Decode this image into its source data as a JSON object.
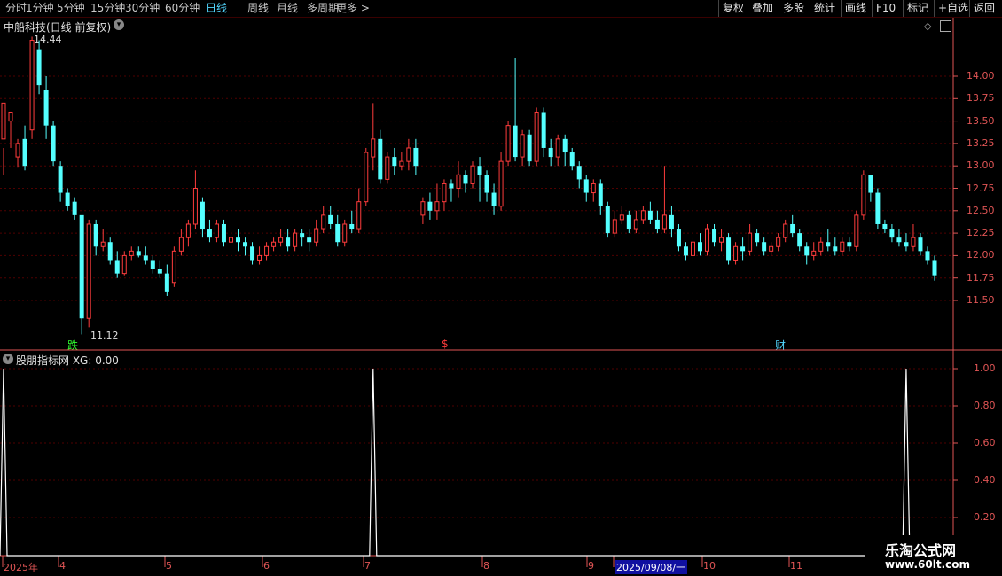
{
  "toolbar": {
    "periods": [
      "分时",
      "1分钟",
      "5分钟",
      "15分钟",
      "30分钟",
      "60分钟",
      "日线",
      "周线",
      "月线",
      "多周期",
      "更多 >"
    ],
    "active_period": "日线",
    "right_buttons": [
      "复权",
      "叠加",
      "多股",
      "统计",
      "画线",
      "F10",
      "标记",
      "+自选",
      "返回"
    ]
  },
  "chart_title": "中船科技(日线 前复权)",
  "indicator_title": "股朋指标网 XG: 0.00",
  "annotations": {
    "high_label": "14.44",
    "low_label": "11.12",
    "marker_die": "跌",
    "marker_dollar": "$",
    "marker_cai": "财"
  },
  "price_axis": [
    "14.00",
    "13.75",
    "13.50",
    "13.25",
    "13.00",
    "12.75",
    "12.50",
    "12.25",
    "12.00",
    "11.75",
    "11.50"
  ],
  "ind_axis": [
    "1.00",
    "0.80",
    "0.60",
    "0.40",
    "0.20"
  ],
  "date_axis": {
    "labels": [
      "2025年",
      "4",
      "5",
      "6",
      "7",
      "8",
      "9",
      "2025/09/08/一",
      "10",
      "11"
    ],
    "highlight": "2025/09/08/一"
  },
  "watermark": {
    "line1": "乐淘公式网",
    "line2": "www.60lt.com"
  },
  "colors": {
    "up": "#ff3c3c",
    "down": "#54ffff",
    "axis": "#e05555",
    "bg": "#000000",
    "active": "#52d7ff"
  },
  "chart_data": {
    "type": "candlestick",
    "y_range": [
      11.1,
      14.5
    ],
    "indicator": {
      "name": "XG",
      "range": [
        0,
        1
      ],
      "signal_candle_index": [
        0,
        52,
        127
      ]
    },
    "candles": [
      [
        13.3,
        13.7,
        13.2,
        12.9
      ],
      [
        13.5,
        13.6,
        13.2,
        13.6
      ],
      [
        13.1,
        13.25,
        12.98,
        13.3
      ],
      [
        13.3,
        13.0,
        12.95,
        13.45
      ],
      [
        13.4,
        14.4,
        13.3,
        14.44
      ],
      [
        14.3,
        13.9,
        13.8,
        14.4
      ],
      [
        13.85,
        13.45,
        13.3,
        14.0
      ],
      [
        13.45,
        13.05,
        13.0,
        13.5
      ],
      [
        13.0,
        12.7,
        12.6,
        13.05
      ],
      [
        12.7,
        12.55,
        12.5,
        12.75
      ],
      [
        12.6,
        12.45,
        12.4,
        12.65
      ],
      [
        12.45,
        11.3,
        11.12,
        12.0
      ],
      [
        11.3,
        12.35,
        11.2,
        12.4
      ],
      [
        12.35,
        12.1,
        12.0,
        12.4
      ],
      [
        12.1,
        12.15,
        12.05,
        12.3
      ],
      [
        12.15,
        11.95,
        11.9,
        12.2
      ],
      [
        11.95,
        11.8,
        11.75,
        12.05
      ],
      [
        11.8,
        12.0,
        11.78,
        12.05
      ],
      [
        12.0,
        12.05,
        11.95,
        12.1
      ],
      [
        12.05,
        12.0,
        11.98,
        12.1
      ],
      [
        12.0,
        11.95,
        11.9,
        12.1
      ],
      [
        11.95,
        11.85,
        11.8,
        12.0
      ],
      [
        11.85,
        11.8,
        11.75,
        11.95
      ],
      [
        11.8,
        11.6,
        11.55,
        11.9
      ],
      [
        11.7,
        12.05,
        11.65,
        12.1
      ],
      [
        12.05,
        12.2,
        12.0,
        12.3
      ],
      [
        12.2,
        12.35,
        12.1,
        12.4
      ],
      [
        12.35,
        12.75,
        12.3,
        12.95
      ],
      [
        12.6,
        12.3,
        12.2,
        12.65
      ],
      [
        12.3,
        12.2,
        12.15,
        12.4
      ],
      [
        12.2,
        12.35,
        12.15,
        12.4
      ],
      [
        12.35,
        12.15,
        12.1,
        12.4
      ],
      [
        12.15,
        12.2,
        12.1,
        12.3
      ],
      [
        12.2,
        12.15,
        12.05,
        12.3
      ],
      [
        12.15,
        12.1,
        12.0,
        12.2
      ],
      [
        12.1,
        11.95,
        11.9,
        12.15
      ],
      [
        11.95,
        12.0,
        11.9,
        12.1
      ],
      [
        12.0,
        12.1,
        11.95,
        12.15
      ],
      [
        12.1,
        12.15,
        12.05,
        12.2
      ],
      [
        12.15,
        12.2,
        12.1,
        12.3
      ],
      [
        12.2,
        12.1,
        12.05,
        12.3
      ],
      [
        12.1,
        12.25,
        12.05,
        12.3
      ],
      [
        12.25,
        12.2,
        12.1,
        12.3
      ],
      [
        12.2,
        12.15,
        12.05,
        12.3
      ],
      [
        12.15,
        12.3,
        12.1,
        12.4
      ],
      [
        12.3,
        12.45,
        12.25,
        12.55
      ],
      [
        12.45,
        12.35,
        12.3,
        12.55
      ],
      [
        12.35,
        12.15,
        12.1,
        12.45
      ],
      [
        12.15,
        12.35,
        12.1,
        12.4
      ],
      [
        12.35,
        12.3,
        12.25,
        12.5
      ],
      [
        12.3,
        12.6,
        12.25,
        12.75
      ],
      [
        12.6,
        13.15,
        12.55,
        13.2
      ],
      [
        13.1,
        13.3,
        12.95,
        13.7
      ],
      [
        13.3,
        12.85,
        12.8,
        13.4
      ],
      [
        12.85,
        13.1,
        12.8,
        13.15
      ],
      [
        13.1,
        13.0,
        12.9,
        13.2
      ],
      [
        13.0,
        13.05,
        12.95,
        13.15
      ],
      [
        13.05,
        13.2,
        12.95,
        13.3
      ],
      [
        13.2,
        13.0,
        12.9,
        13.3
      ],
      [
        12.45,
        12.6,
        12.35,
        12.65
      ],
      [
        12.6,
        12.5,
        12.4,
        12.7
      ],
      [
        12.5,
        12.6,
        12.4,
        12.8
      ],
      [
        12.6,
        12.8,
        12.5,
        12.85
      ],
      [
        12.8,
        12.75,
        12.6,
        12.85
      ],
      [
        12.75,
        12.9,
        12.65,
        13.05
      ],
      [
        12.9,
        12.8,
        12.7,
        12.95
      ],
      [
        12.8,
        13.0,
        12.75,
        13.05
      ],
      [
        13.0,
        12.9,
        12.6,
        13.1
      ],
      [
        12.9,
        12.7,
        12.6,
        12.95
      ],
      [
        12.7,
        12.55,
        12.45,
        12.8
      ],
      [
        12.55,
        13.05,
        12.5,
        13.15
      ],
      [
        13.05,
        13.45,
        13.0,
        13.5
      ],
      [
        13.45,
        13.1,
        13.05,
        14.2
      ],
      [
        13.1,
        13.35,
        13.0,
        13.4
      ],
      [
        13.35,
        13.05,
        13.0,
        13.4
      ],
      [
        13.05,
        13.6,
        13.0,
        13.65
      ],
      [
        13.6,
        13.2,
        13.1,
        13.65
      ],
      [
        13.2,
        13.1,
        13.0,
        13.3
      ],
      [
        13.1,
        13.3,
        13.0,
        13.35
      ],
      [
        13.3,
        13.15,
        13.0,
        13.35
      ],
      [
        13.15,
        13.0,
        12.95,
        13.2
      ],
      [
        13.0,
        12.85,
        12.75,
        13.05
      ],
      [
        12.85,
        12.7,
        12.6,
        12.9
      ],
      [
        12.7,
        12.8,
        12.6,
        12.85
      ],
      [
        12.8,
        12.55,
        12.45,
        12.85
      ],
      [
        12.55,
        12.25,
        12.2,
        12.6
      ],
      [
        12.25,
        12.4,
        12.2,
        12.5
      ],
      [
        12.4,
        12.45,
        12.35,
        12.55
      ],
      [
        12.45,
        12.3,
        12.25,
        12.5
      ],
      [
        12.3,
        12.4,
        12.25,
        12.5
      ],
      [
        12.4,
        12.5,
        12.35,
        12.55
      ],
      [
        12.5,
        12.4,
        12.35,
        12.6
      ],
      [
        12.4,
        12.3,
        12.25,
        12.5
      ],
      [
        12.3,
        12.45,
        12.25,
        13.0
      ],
      [
        12.45,
        12.3,
        12.2,
        12.55
      ],
      [
        12.3,
        12.1,
        12.05,
        12.35
      ],
      [
        12.1,
        12.0,
        11.95,
        12.15
      ],
      [
        12.0,
        12.15,
        11.95,
        12.2
      ],
      [
        12.15,
        12.05,
        12.0,
        12.25
      ],
      [
        12.05,
        12.3,
        12.0,
        12.35
      ],
      [
        12.3,
        12.15,
        12.1,
        12.35
      ],
      [
        12.15,
        12.2,
        12.05,
        12.3
      ],
      [
        12.2,
        11.95,
        11.9,
        12.25
      ],
      [
        11.95,
        12.1,
        11.9,
        12.15
      ],
      [
        12.1,
        12.05,
        11.95,
        12.2
      ],
      [
        12.05,
        12.25,
        12.0,
        12.35
      ],
      [
        12.25,
        12.15,
        12.1,
        12.3
      ],
      [
        12.15,
        12.05,
        12.0,
        12.2
      ],
      [
        12.05,
        12.1,
        12.0,
        12.15
      ],
      [
        12.1,
        12.2,
        12.05,
        12.25
      ],
      [
        12.2,
        12.35,
        12.15,
        12.4
      ],
      [
        12.35,
        12.25,
        12.2,
        12.45
      ],
      [
        12.25,
        12.1,
        12.05,
        12.3
      ],
      [
        12.1,
        12.0,
        11.9,
        12.15
      ],
      [
        12.0,
        12.05,
        11.95,
        12.15
      ],
      [
        12.05,
        12.15,
        12.0,
        12.2
      ],
      [
        12.15,
        12.1,
        12.05,
        12.3
      ],
      [
        12.1,
        12.05,
        12.0,
        12.2
      ],
      [
        12.05,
        12.15,
        12.0,
        12.2
      ],
      [
        12.15,
        12.1,
        12.05,
        12.2
      ],
      [
        12.1,
        12.45,
        12.05,
        12.5
      ],
      [
        12.45,
        12.9,
        12.4,
        12.95
      ],
      [
        12.9,
        12.7,
        12.6,
        12.75
      ],
      [
        12.7,
        12.35,
        12.3,
        12.75
      ],
      [
        12.35,
        12.3,
        12.25,
        12.4
      ],
      [
        12.3,
        12.2,
        12.15,
        12.35
      ],
      [
        12.2,
        12.15,
        12.1,
        12.3
      ],
      [
        12.15,
        12.1,
        12.05,
        12.25
      ],
      [
        12.1,
        12.2,
        12.05,
        12.35
      ],
      [
        12.2,
        12.05,
        12.0,
        12.25
      ],
      [
        12.05,
        11.95,
        11.9,
        12.1
      ],
      [
        11.95,
        11.78,
        11.72,
        12.0
      ]
    ]
  }
}
